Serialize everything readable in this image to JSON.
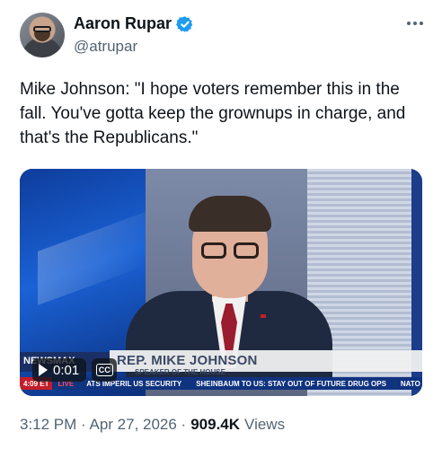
{
  "tweet": {
    "author": {
      "display_name": "Aaron Rupar",
      "handle": "@atrupar",
      "verified": true,
      "avatar_icon": "user-avatar"
    },
    "text": "Mike Johnson: \"I hope voters remember this in the fall. You've gotta keep the grownups in charge, and that's the Republicans.\"",
    "timestamp": "3:12 PM · Apr 27, 2026 ·",
    "views_count": "909.4K",
    "views_label": "Views"
  },
  "video": {
    "elapsed": "0:01",
    "cc_label": "CC",
    "lower_third": {
      "network": "NEWSMAX",
      "name": "REP. MIKE JOHNSON",
      "subtitle": "SPEAKER OF THE HOUSE"
    },
    "ticker": {
      "time": "4:09 ET",
      "live": "LIVE",
      "items": [
        "ATS IMPERIL US SECURITY",
        "SHEINBAUM TO US: STAY OUT OF FUTURE DRUG OPS",
        "NATO"
      ]
    }
  },
  "colors": {
    "verified_blue": "#1d9bf0",
    "text_primary": "#0f1419",
    "text_secondary": "#536471",
    "ticker_blue": "#10337f"
  }
}
